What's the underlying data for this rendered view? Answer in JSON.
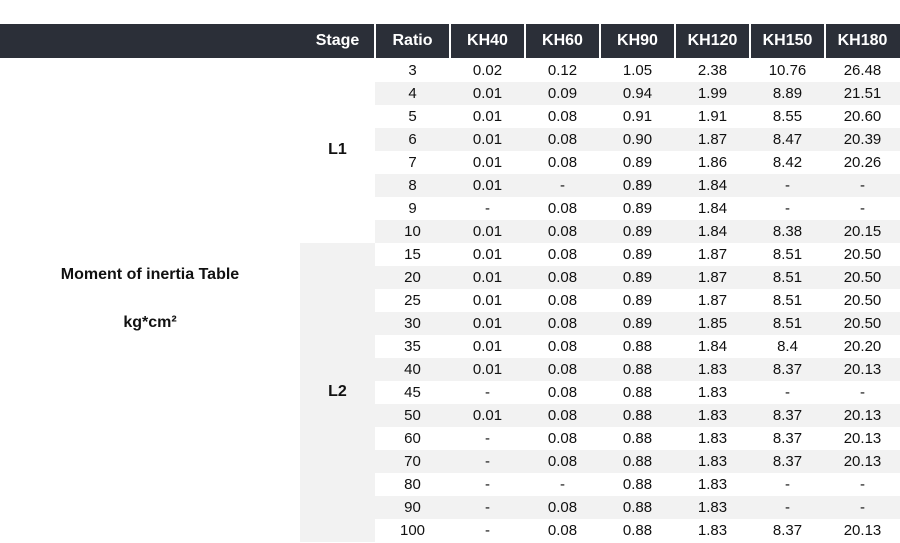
{
  "side_labels": {
    "title": "Moment of inertia Table",
    "unit": "kg*cm²"
  },
  "columns": [
    "Stage",
    "Ratio",
    "KH40",
    "KH60",
    "KH90",
    "KH120",
    "KH150",
    "KH180"
  ],
  "groups": [
    {
      "stage": "L1",
      "rows": [
        [
          "3",
          "0.02",
          "0.12",
          "1.05",
          "2.38",
          "10.76",
          "26.48"
        ],
        [
          "4",
          "0.01",
          "0.09",
          "0.94",
          "1.99",
          "8.89",
          "21.51"
        ],
        [
          "5",
          "0.01",
          "0.08",
          "0.91",
          "1.91",
          "8.55",
          "20.60"
        ],
        [
          "6",
          "0.01",
          "0.08",
          "0.90",
          "1.87",
          "8.47",
          "20.39"
        ],
        [
          "7",
          "0.01",
          "0.08",
          "0.89",
          "1.86",
          "8.42",
          "20.26"
        ],
        [
          "8",
          "0.01",
          "-",
          "0.89",
          "1.84",
          "-",
          "-"
        ],
        [
          "9",
          "-",
          "0.08",
          "0.89",
          "1.84",
          "-",
          "-"
        ],
        [
          "10",
          "0.01",
          "0.08",
          "0.89",
          "1.84",
          "8.38",
          "20.15"
        ]
      ]
    },
    {
      "stage": "L2",
      "rows": [
        [
          "15",
          "0.01",
          "0.08",
          "0.89",
          "1.87",
          "8.51",
          "20.50"
        ],
        [
          "20",
          "0.01",
          "0.08",
          "0.89",
          "1.87",
          "8.51",
          "20.50"
        ],
        [
          "25",
          "0.01",
          "0.08",
          "0.89",
          "1.87",
          "8.51",
          "20.50"
        ],
        [
          "30",
          "0.01",
          "0.08",
          "0.89",
          "1.85",
          "8.51",
          "20.50"
        ],
        [
          "35",
          "0.01",
          "0.08",
          "0.88",
          "1.84",
          "8.4",
          "20.20"
        ],
        [
          "40",
          "0.01",
          "0.08",
          "0.88",
          "1.83",
          "8.37",
          "20.13"
        ],
        [
          "45",
          "-",
          "0.08",
          "0.88",
          "1.83",
          "-",
          "-"
        ],
        [
          "50",
          "0.01",
          "0.08",
          "0.88",
          "1.83",
          "8.37",
          "20.13"
        ],
        [
          "60",
          "-",
          "0.08",
          "0.88",
          "1.83",
          "8.37",
          "20.13"
        ],
        [
          "70",
          "-",
          "0.08",
          "0.88",
          "1.83",
          "8.37",
          "20.13"
        ],
        [
          "80",
          "-",
          "-",
          "0.88",
          "1.83",
          "-",
          "-"
        ],
        [
          "90",
          "-",
          "0.08",
          "0.88",
          "1.83",
          "-",
          "-"
        ],
        [
          "100",
          "-",
          "0.08",
          "0.88",
          "1.83",
          "8.37",
          "20.13"
        ]
      ]
    }
  ]
}
